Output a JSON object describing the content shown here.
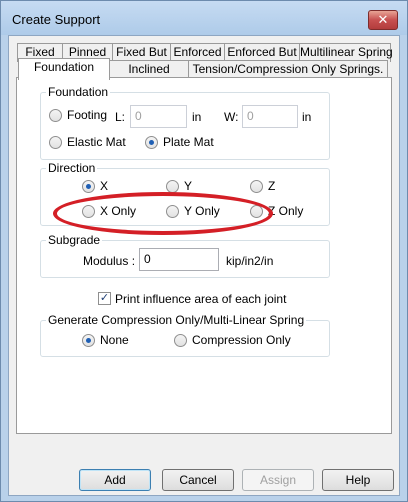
{
  "window": {
    "title": "Create Support",
    "close_glyph": "✕"
  },
  "tabs": {
    "row1": [
      "Fixed",
      "Pinned",
      "Fixed But",
      "Enforced",
      "Enforced But",
      "Multilinear Spring"
    ],
    "row2": [
      "Foundation",
      "Inclined",
      "Tension/Compression Only Springs."
    ],
    "active": "Foundation"
  },
  "foundation": {
    "title": "Foundation",
    "footing_label": "Footing",
    "footing_checked": false,
    "l_label": "L:",
    "l_value": "0",
    "l_unit": "in",
    "w_label": "W:",
    "w_value": "0",
    "w_unit": "in",
    "elastic_mat_label": "Elastic Mat",
    "elastic_mat_checked": false,
    "plate_mat_label": "Plate Mat",
    "plate_mat_checked": true
  },
  "direction": {
    "title": "Direction",
    "options": [
      {
        "label": "X",
        "checked": true
      },
      {
        "label": "Y",
        "checked": false
      },
      {
        "label": "Z",
        "checked": false
      },
      {
        "label": "X Only",
        "checked": false
      },
      {
        "label": "Y Only",
        "checked": false
      },
      {
        "label": "Z Only",
        "checked": false
      }
    ]
  },
  "subgrade": {
    "title": "Subgrade",
    "modulus_label": "Modulus :",
    "modulus_value": "0",
    "modulus_unit": "kip/in2/in"
  },
  "print_influence": {
    "label": "Print influence area of each joint",
    "checked": true,
    "check_glyph": "✓"
  },
  "compression": {
    "title": "Generate Compression Only/Multi-Linear Spring",
    "none_label": "None",
    "none_checked": true,
    "compression_only_label": "Compression Only",
    "compression_only_checked": false
  },
  "buttons": {
    "add": "Add",
    "cancel": "Cancel",
    "assign": "Assign",
    "help": "Help"
  },
  "colors": {
    "highlight": "#d41f26",
    "accent": "#1f5fb4"
  }
}
